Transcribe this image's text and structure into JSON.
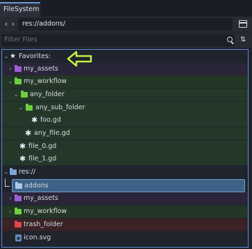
{
  "tab": {
    "title": "FileSystem"
  },
  "path": {
    "value": "res://addons/"
  },
  "filter": {
    "placeholder": "Filter Files"
  },
  "tree": {
    "favorites_label": "Favorites:",
    "res_label": "res://",
    "items": [
      {
        "label": "my_assets",
        "folder_color": "#9b5fd6"
      },
      {
        "label": "my_workflow",
        "folder_color": "#6fcf3f"
      },
      {
        "label": "any_folder",
        "folder_color": "#6fcf3f"
      },
      {
        "label": "any_sub_folder",
        "folder_color": "#6fcf3f"
      },
      {
        "label": "foo.gd"
      },
      {
        "label": "any_file.gd"
      },
      {
        "label": "file_0.gd"
      },
      {
        "label": "file_1.gd"
      },
      {
        "label": "addons",
        "folder_color": "#7fa7d6"
      },
      {
        "label": "my_assets",
        "folder_color": "#9b5fd6"
      },
      {
        "label": "my_workflow",
        "folder_color": "#6fcf3f"
      },
      {
        "label": "trash_folder",
        "folder_color": "#e0474f"
      },
      {
        "label": "icon.svg"
      }
    ]
  },
  "colors": {
    "accent": "#5c8fcf",
    "green_tint": "#24382a",
    "purple_tint": "#2c2638",
    "red_tint": "#3a2226",
    "selection": "#3e6186",
    "annotation_arrow": "#c6f046"
  }
}
